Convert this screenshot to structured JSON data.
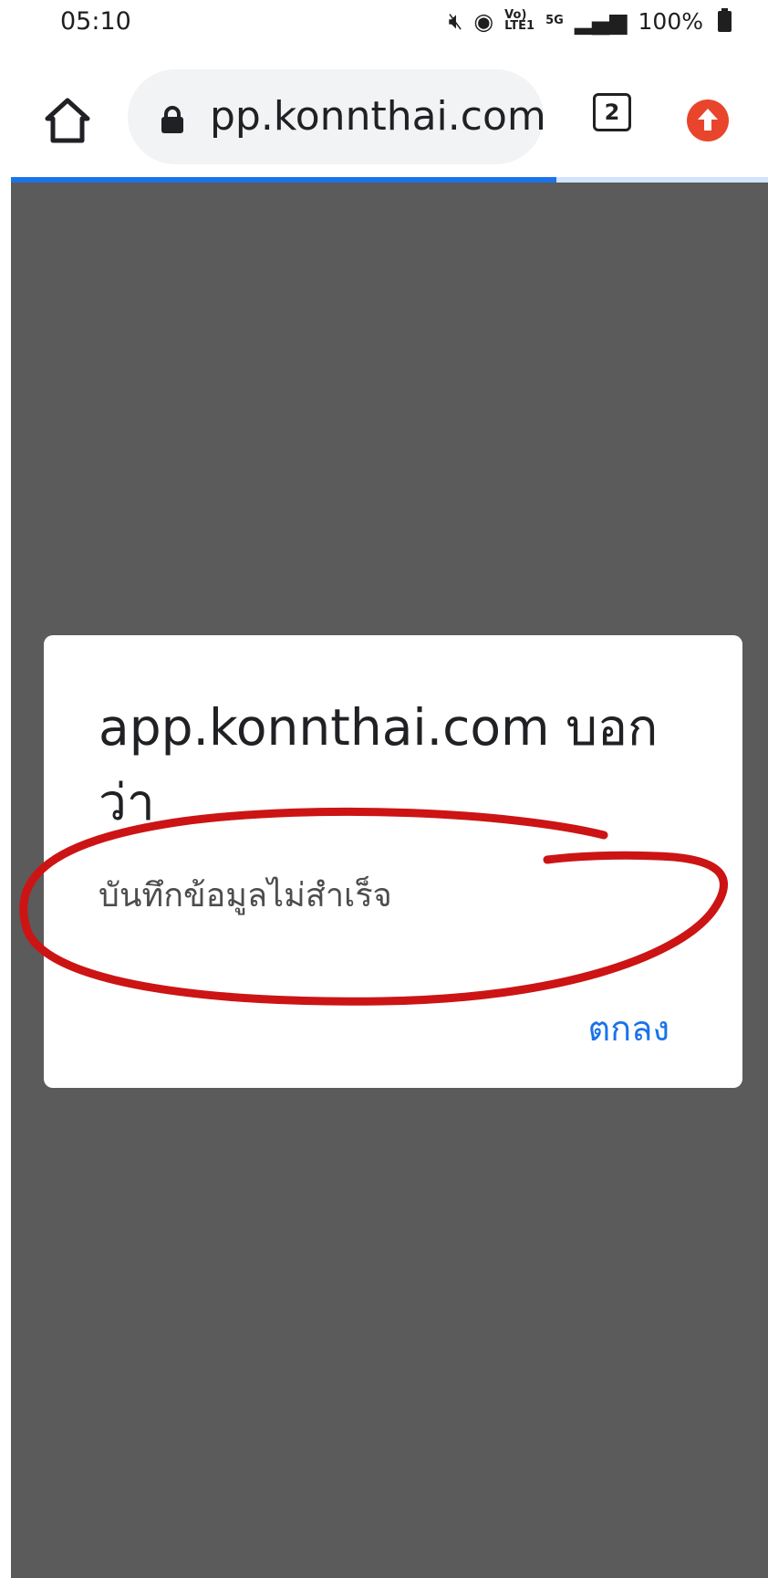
{
  "status_bar": {
    "time": "05:10",
    "network_small_top": "Vo)",
    "network_small_bottom": "LTE1",
    "network_5g": "5G",
    "battery": "100%"
  },
  "browser": {
    "url": "pp.konnthai.com",
    "tab_count": "2",
    "page_load_progress": 0.72
  },
  "dialog": {
    "title": "app.konnthai.com บอกว่า",
    "message": "บันทึกข้อมูลไม่สำเร็จ",
    "ok_label": "ตกลง"
  },
  "colors": {
    "accent": "#1a73e8",
    "overlay": "#5b5b5b",
    "annotation": "#cc1414",
    "update_icon": "#e8452c"
  }
}
